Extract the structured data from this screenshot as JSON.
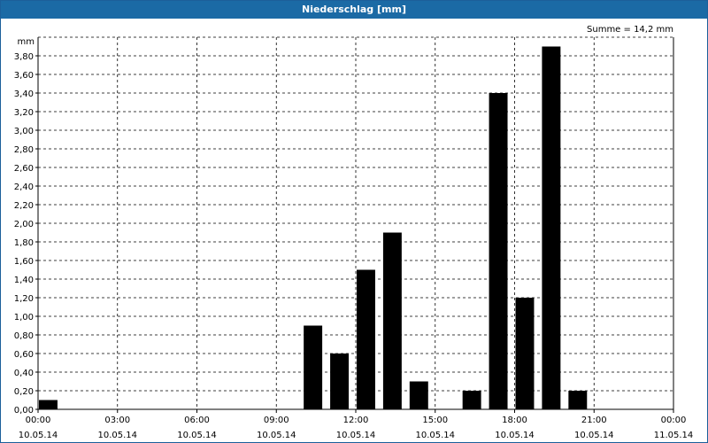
{
  "window": {
    "title": "Niederschlag [mm]"
  },
  "chart_data": {
    "type": "bar",
    "title": "Niederschlag [mm]",
    "ylabel": "mm",
    "annotation": "Summe = 14,2 mm",
    "ylim": [
      0,
      4.0
    ],
    "xlim_hours": [
      0,
      24
    ],
    "grid": true,
    "y_ticks": [
      "0,00",
      "0,20",
      "0,40",
      "0,60",
      "0,80",
      "1,00",
      "1,20",
      "1,40",
      "1,60",
      "1,80",
      "2,00",
      "2,20",
      "2,40",
      "2,60",
      "2,80",
      "3,00",
      "3,20",
      "3,40",
      "3,60",
      "3,80"
    ],
    "x_ticks": [
      {
        "time": "00:00",
        "date": "10.05.14"
      },
      {
        "time": "03:00",
        "date": "10.05.14"
      },
      {
        "time": "06:00",
        "date": "10.05.14"
      },
      {
        "time": "09:00",
        "date": "10.05.14"
      },
      {
        "time": "12:00",
        "date": "10.05.14"
      },
      {
        "time": "15:00",
        "date": "10.05.14"
      },
      {
        "time": "18:00",
        "date": "10.05.14"
      },
      {
        "time": "21:00",
        "date": "10.05.14"
      },
      {
        "time": "00:00",
        "date": "11.05.14"
      }
    ],
    "series": [
      {
        "color": "#000000",
        "points": [
          {
            "x": "10.05.14 00:00",
            "y": 0.1
          },
          {
            "x": "10.05.14 10:00",
            "y": 0.9
          },
          {
            "x": "10.05.14 11:00",
            "y": 0.6
          },
          {
            "x": "10.05.14 12:00",
            "y": 1.5
          },
          {
            "x": "10.05.14 13:00",
            "y": 1.9
          },
          {
            "x": "10.05.14 14:00",
            "y": 0.3
          },
          {
            "x": "10.05.14 16:00",
            "y": 0.2
          },
          {
            "x": "10.05.14 17:00",
            "y": 3.4
          },
          {
            "x": "10.05.14 18:00",
            "y": 1.2
          },
          {
            "x": "10.05.14 19:00",
            "y": 3.9
          },
          {
            "x": "10.05.14 20:00",
            "y": 0.2
          }
        ]
      }
    ]
  }
}
